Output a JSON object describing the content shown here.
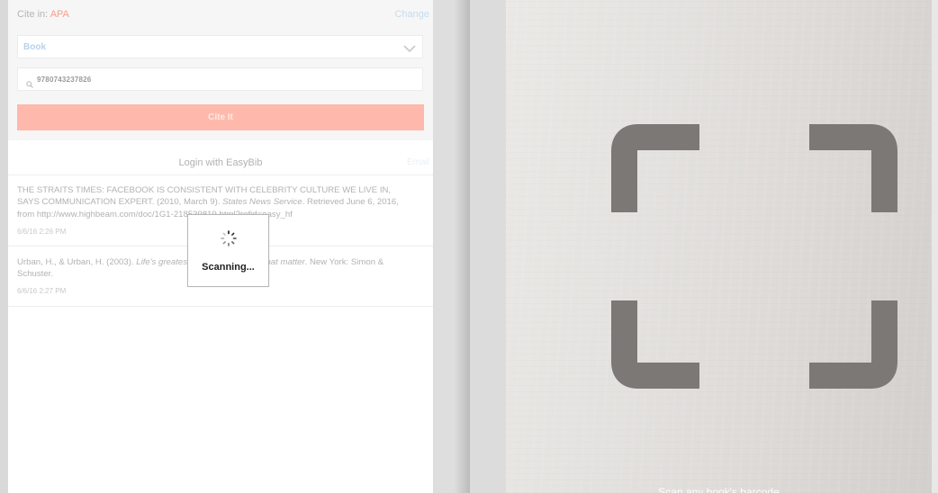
{
  "form": {
    "cite_in_label": "Cite in:",
    "cite_in_value": "APA",
    "change_label": "Change",
    "source_type": "Book",
    "search_value": "9780743237826",
    "cite_button_label": "Cite It"
  },
  "login": {
    "label": "Login with EasyBib",
    "email_label": "Email"
  },
  "citations": [
    {
      "text_before": "THE STRAITS TIMES: FACEBOOK IS CONSISTENT WITH CELEBRITY CULTURE WE LIVE IN, SAYS COMMUNICATION EXPERT. (2010, March 9). ",
      "text_italic": "States News Service",
      "text_after": ". Retrieved June 6, 2016, from http://www.highbeam.com/doc/1G1-218539819.html?refid=easy_hf",
      "date": "6/6/16 2:26 PM"
    },
    {
      "text_before": "Urban, H., & Urban, H. (2003). ",
      "text_italic": "Life's greatest lessons: 20 things that matter",
      "text_after": ". New York: Simon & Schuster.",
      "date": "6/6/16 2:27 PM"
    }
  ],
  "scanning": {
    "label": "Scanning..."
  },
  "camera": {
    "hint": "Scan any book's barcode"
  },
  "colors": {
    "accent": "#f5a28c",
    "cite_button": "#ffb9ac",
    "link": "#c6dcef",
    "scan_frame": "#7b7876"
  },
  "icons": {
    "dropdown": "chevron-down-icon",
    "search": "search-icon",
    "spinner": "spinner-icon",
    "scan_frame": "scan-frame-icon"
  }
}
